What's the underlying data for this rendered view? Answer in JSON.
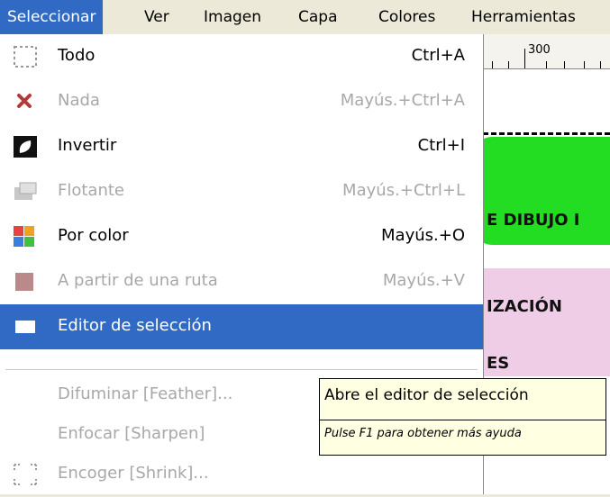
{
  "menubar": {
    "items": [
      "Seleccionar",
      "Ver",
      "Imagen",
      "Capa",
      "Colores",
      "Herramientas"
    ]
  },
  "ruler": {
    "value": "300"
  },
  "canvas": {
    "texts": [
      "E DIBUJO I",
      "IZACIÓN",
      "ES"
    ]
  },
  "menu": {
    "items": [
      {
        "label": "Todo",
        "shortcut": "Ctrl+A",
        "icon": "select-all-icon",
        "enabled": true
      },
      {
        "label": "Nada",
        "shortcut": "Mayús.+Ctrl+A",
        "icon": "select-none-icon",
        "enabled": false
      },
      {
        "label": "Invertir",
        "shortcut": "Ctrl+I",
        "icon": "invert-selection-icon",
        "enabled": true
      },
      {
        "label": "Flotante",
        "shortcut": "Mayús.+Ctrl+L",
        "icon": "float-selection-icon",
        "enabled": false
      },
      {
        "label": "Por color",
        "shortcut": "Mayús.+O",
        "icon": "select-by-color-icon",
        "enabled": true
      },
      {
        "label": "A partir de una ruta",
        "shortcut": "Mayús.+V",
        "icon": "selection-from-path-icon",
        "enabled": false
      },
      {
        "label": "Editor de selección",
        "shortcut": "",
        "icon": "selection-editor-icon",
        "enabled": true,
        "selected": true
      },
      {
        "label": "Difuminar [Feather]...",
        "shortcut": "",
        "icon": "",
        "enabled": false
      },
      {
        "label": "Enfocar [Sharpen]",
        "shortcut": "",
        "icon": "",
        "enabled": false
      },
      {
        "label": "Encoger [Shrink]...",
        "shortcut": "",
        "icon": "shrink-icon",
        "enabled": false
      }
    ]
  },
  "tooltip": {
    "title": "Abre el editor de selección",
    "hint": "Pulse F1 para obtener más ayuda"
  },
  "colors": {
    "accent": "#316ac5",
    "menubar_bg": "#ece9d8",
    "tooltip_bg": "#ffffe1",
    "disabled_text": "#a8a8a8"
  }
}
